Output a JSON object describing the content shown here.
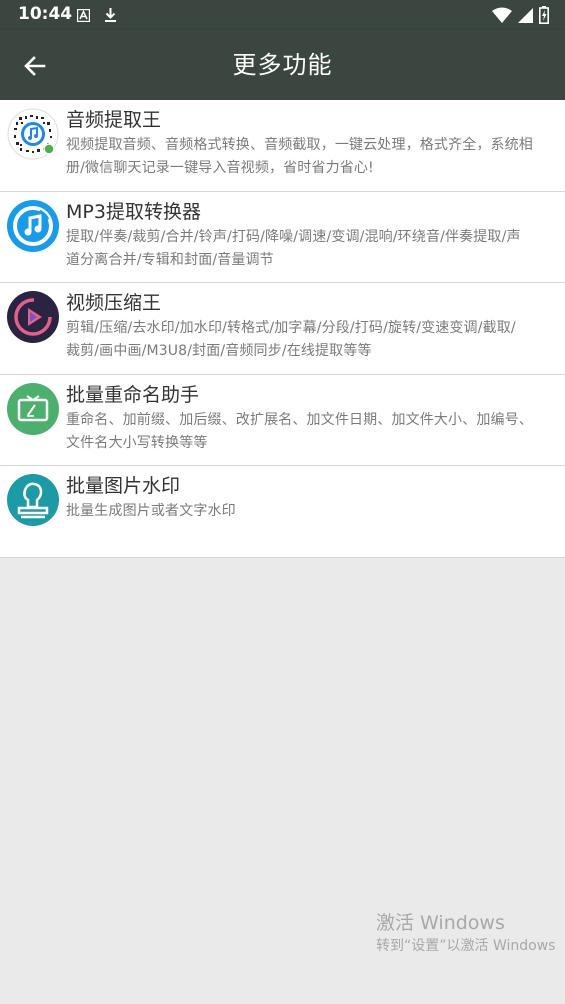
{
  "status_bar": {
    "time": "10:44",
    "icons_left": [
      "font-icon",
      "download-icon"
    ],
    "icons_right": [
      "wifi-icon",
      "signal-icon",
      "battery-icon"
    ]
  },
  "app_bar": {
    "title": "更多功能",
    "back_icon": "arrow-left-icon"
  },
  "colors": {
    "app_bar_bg": "#3b4640",
    "page_bg": "#ebeaeb",
    "list_bg": "#ffffff",
    "title_text": "#333333",
    "desc_text": "#7a7a7a"
  },
  "items": [
    {
      "title": "音频提取王",
      "desc": [
        "视频提取音频、音频格式转换、音频截取，一键云处理，格式齐全，系统相",
        "册/微信聊天记录一键导入音视频，省时省力省心!"
      ],
      "icon": "qr-code-icon"
    },
    {
      "title": "MP3提取转换器",
      "desc": [
        "提取/伴奏/裁剪/合并/铃声/打码/降噪/调速/变调/混响/环绕音/伴奏提取/声",
        "道分离合并/专辑和封面/音量调节"
      ],
      "icon": "music-note-icon"
    },
    {
      "title": "视频压缩王",
      "desc": [
        "剪辑/压缩/去水印/加水印/转格式/加字幕/分段/打码/旋转/变速变调/截取/",
        "裁剪/画中画/M3U8/封面/音频同步/在线提取等等"
      ],
      "icon": "video-play-icon"
    },
    {
      "title": "批量重命名助手",
      "desc": [
        "重命名、加前缀、加后缀、改扩展名、加文件日期、加文件大小、加编号、",
        "文件名大小写转换等等"
      ],
      "icon": "rename-tv-icon"
    },
    {
      "title": "批量图片水印",
      "desc": [
        "批量生成图片或者文字水印"
      ],
      "icon": "stamp-icon"
    }
  ],
  "watermark": {
    "line1": "激活 Windows",
    "line2": "转到“设置”以激活 Windows"
  }
}
